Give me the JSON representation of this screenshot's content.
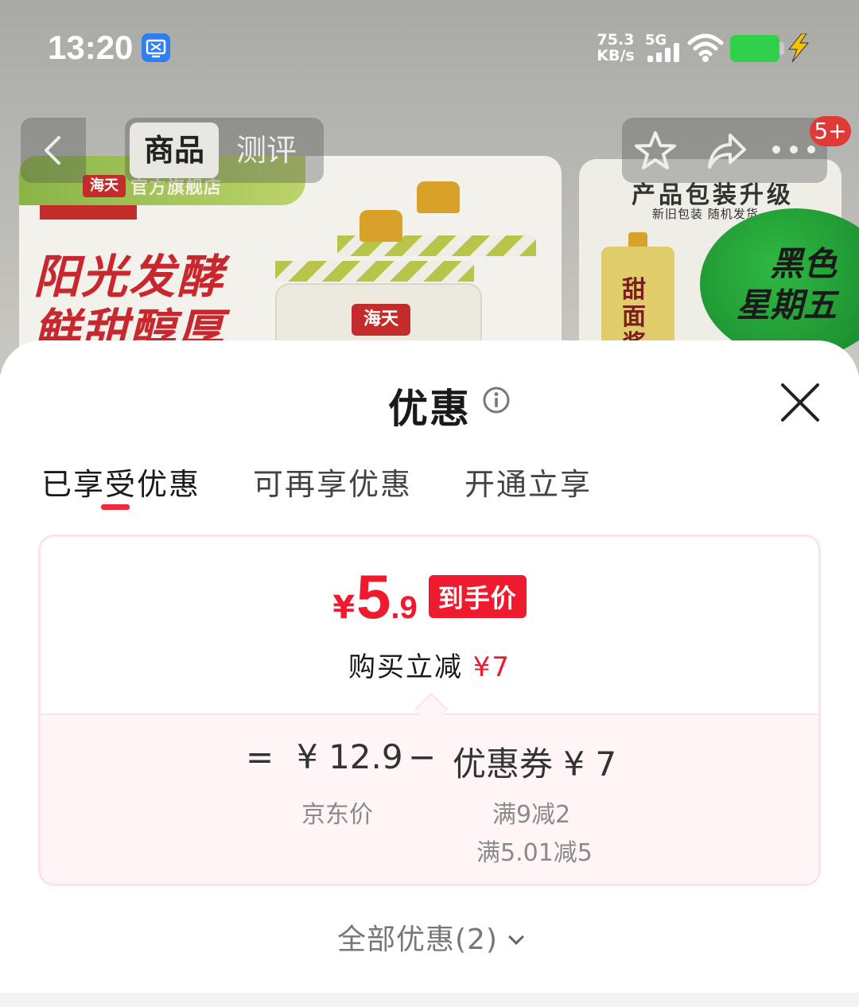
{
  "status_bar": {
    "time": "13:20",
    "net_speed_value": "75.3",
    "net_speed_unit": "KB/s",
    "network": "5G",
    "icons": [
      "screencast-icon",
      "signal-icon",
      "wifi-icon",
      "battery-icon",
      "charging-icon"
    ]
  },
  "background_page": {
    "tabs": [
      "商品",
      "测评"
    ],
    "store_logo": "海天",
    "store_name": "官方旗舰店",
    "slogan_line1": "阳光发酵",
    "slogan_line2": "鲜甜醇厚",
    "bottle_logo": "海天",
    "promo_title": "产品包装升级",
    "promo_sub": "新旧包装  随机发货",
    "promo_bottle_label": "甜面酱",
    "black_friday_line1": "黑色",
    "black_friday_line2": "星期五",
    "cart_badge": "5+"
  },
  "sheet": {
    "title": "优惠",
    "tabs": [
      "已享受优惠",
      "可再享优惠",
      "开通立享"
    ],
    "active_tab": 0,
    "price": {
      "currency": "¥",
      "integer": "5",
      "decimal": ".9",
      "tag": "到手价",
      "save_label": "购买立减",
      "save_amount": "¥7"
    },
    "formula": {
      "equals": "=",
      "jd_price": "¥ 12.9",
      "jd_price_label": "京东价",
      "minus": "−",
      "coupon": "优惠券 ¥ 7",
      "coupon_rules": [
        "满9减2",
        "满5.01减5"
      ]
    },
    "all_deals": "全部优惠(2)"
  },
  "colors": {
    "accent_red": "#f01a2e",
    "battery_green": "#2fd14a",
    "card_border": "#fde3e8",
    "card_bottom_bg": "#fff5f6"
  }
}
